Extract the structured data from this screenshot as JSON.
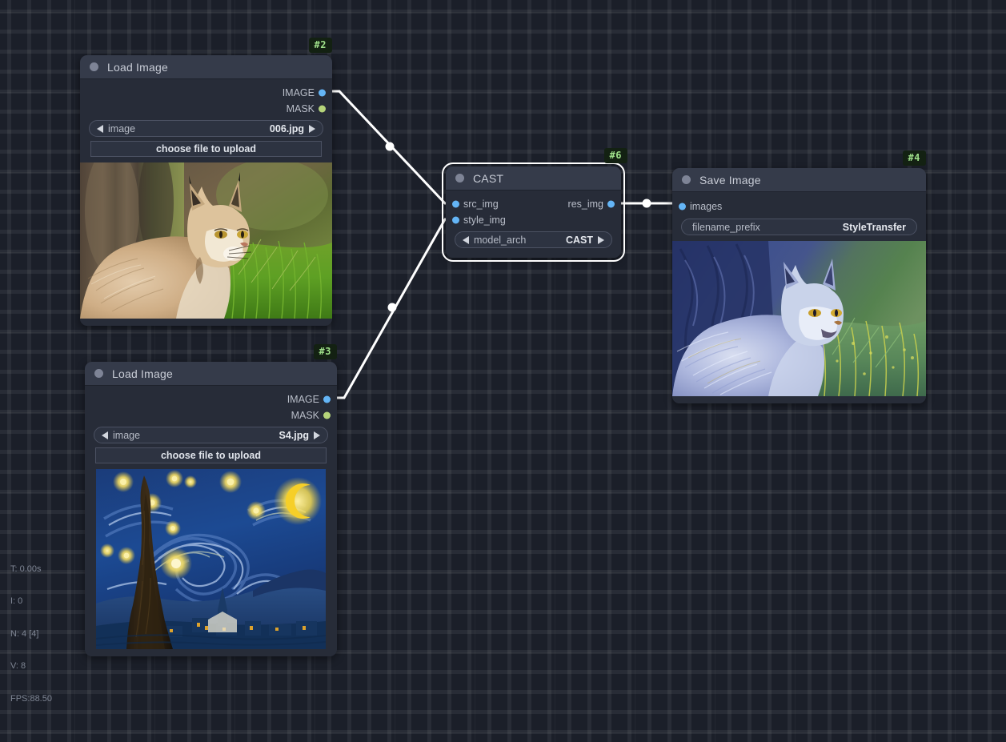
{
  "app": {
    "name": "ComfyUI Node Graph"
  },
  "canvas": {
    "background_color": "#1b1f29",
    "grid_line_color": "#2a2f3b",
    "link_color": "#ffffff"
  },
  "nodes": [
    {
      "id": "#2",
      "title": "Load Image",
      "type": "LoadImage",
      "selected": false,
      "outputs": [
        {
          "label": "IMAGE",
          "color": "#64b5f6"
        },
        {
          "label": "MASK",
          "color": "#b5d47a"
        }
      ],
      "widgets": [
        {
          "kind": "combo",
          "name": "image",
          "value": "006.jpg"
        },
        {
          "kind": "button",
          "label": "choose file to upload"
        }
      ],
      "preview": {
        "alt": "photograph of a lynx sitting in green grass"
      }
    },
    {
      "id": "#3",
      "title": "Load Image",
      "type": "LoadImage",
      "selected": false,
      "outputs": [
        {
          "label": "IMAGE",
          "color": "#64b5f6"
        },
        {
          "label": "MASK",
          "color": "#b5d47a"
        }
      ],
      "widgets": [
        {
          "kind": "combo",
          "name": "image",
          "value": "S4.jpg"
        },
        {
          "kind": "button",
          "label": "choose file to upload"
        }
      ],
      "preview": {
        "alt": "Van Gogh The Starry Night painting"
      }
    },
    {
      "id": "#6",
      "title": "CAST",
      "type": "CAST",
      "selected": true,
      "inputs": [
        {
          "label": "src_img",
          "color": "#64b5f6"
        },
        {
          "label": "style_img",
          "color": "#64b5f6"
        }
      ],
      "outputs": [
        {
          "label": "res_img",
          "color": "#64b5f6"
        }
      ],
      "widgets": [
        {
          "kind": "combo",
          "name": "model_arch",
          "value": "CAST"
        }
      ]
    },
    {
      "id": "#4",
      "title": "Save Image",
      "type": "SaveImage",
      "selected": false,
      "inputs": [
        {
          "label": "images",
          "color": "#64b5f6"
        }
      ],
      "widgets": [
        {
          "kind": "text",
          "name": "filename_prefix",
          "value": "StyleTransfer"
        }
      ],
      "preview": {
        "alt": "style-transferred lynx rendered in blue and green brushstrokes"
      }
    }
  ],
  "links": [
    {
      "from": "#2.IMAGE",
      "to": "#6.src_img"
    },
    {
      "from": "#3.IMAGE",
      "to": "#6.style_img"
    },
    {
      "from": "#6.res_img",
      "to": "#4.images"
    }
  ],
  "status": {
    "time_label": "T: 0.00s",
    "iterations_label": "I: 0",
    "nodes_label": "N: 4 [4]",
    "vertices_label": "V: 8",
    "fps_label": "FPS:88.50"
  }
}
